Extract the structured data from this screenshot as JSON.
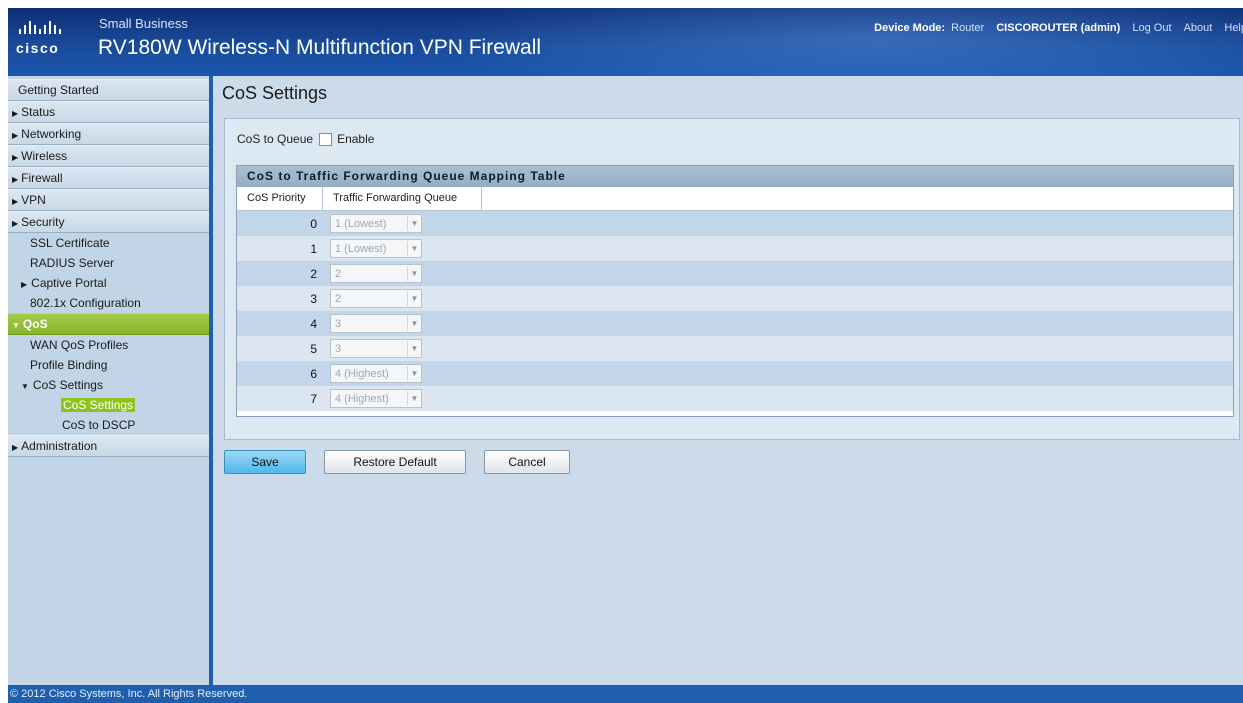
{
  "header": {
    "brand": "cisco",
    "small_business": "Small Business",
    "product": "RV180W Wireless-N Multifunction VPN Firewall",
    "device_mode_label": "Device Mode:",
    "device_mode_value": "Router",
    "user": "CISCOROUTER (admin)",
    "logout": "Log Out",
    "about": "About",
    "help": "Help"
  },
  "sidebar": {
    "getting_started": "Getting Started",
    "status": "Status",
    "networking": "Networking",
    "wireless": "Wireless",
    "firewall": "Firewall",
    "vpn": "VPN",
    "security": "Security",
    "ssl_certificate": "SSL Certificate",
    "radius_server": "RADIUS Server",
    "captive_portal": "Captive Portal",
    "dot1x": "802.1x Configuration",
    "qos": "QoS",
    "wan_qos_profiles": "WAN QoS Profiles",
    "profile_binding": "Profile Binding",
    "cos_settings_group": "CoS Settings",
    "cos_settings_active": "CoS Settings",
    "cos_to_dscp": "CoS to DSCP",
    "administration": "Administration"
  },
  "main": {
    "title": "CoS Settings",
    "cos_to_queue_label": "CoS to Queue",
    "enable_label": "Enable",
    "table_title": "CoS to Traffic Forwarding Queue Mapping Table",
    "col_priority": "CoS Priority",
    "col_queue": "Traffic Forwarding Queue",
    "rows": [
      {
        "priority": "0",
        "queue": "1 (Lowest)"
      },
      {
        "priority": "1",
        "queue": "1 (Lowest)"
      },
      {
        "priority": "2",
        "queue": "2"
      },
      {
        "priority": "3",
        "queue": "2"
      },
      {
        "priority": "4",
        "queue": "3"
      },
      {
        "priority": "5",
        "queue": "3"
      },
      {
        "priority": "6",
        "queue": "4 (Highest)"
      },
      {
        "priority": "7",
        "queue": "4 (Highest)"
      }
    ],
    "save": "Save",
    "restore": "Restore Default",
    "cancel": "Cancel"
  },
  "footer": "© 2012 Cisco Systems, Inc. All Rights Reserved."
}
